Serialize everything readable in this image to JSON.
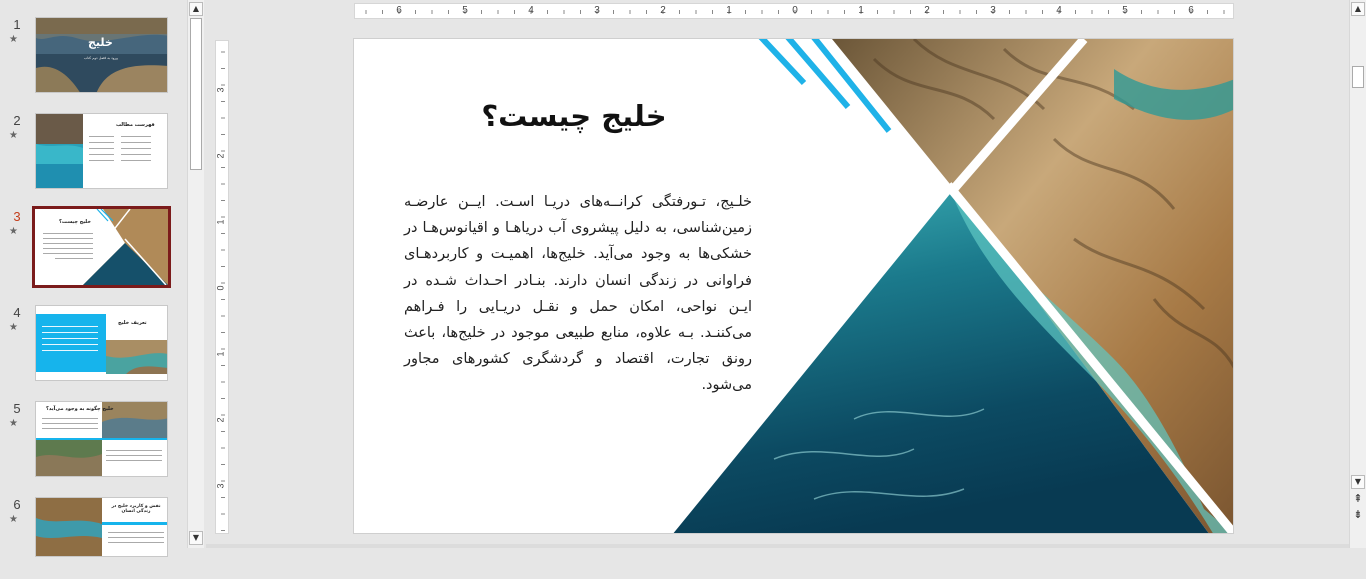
{
  "thumbnails": [
    {
      "number": "1",
      "star": "★",
      "title": "خلیج",
      "subtitle": "ورود به فصل دوم کتاب"
    },
    {
      "number": "2",
      "star": "★",
      "title": "فهرست مطالب"
    },
    {
      "number": "3",
      "star": "★",
      "title": "خلیج چیست؟",
      "selected": true
    },
    {
      "number": "4",
      "star": "★",
      "title": "تعریف خلیج"
    },
    {
      "number": "5",
      "star": "★",
      "title": "خلیج چگونه به وجود می‌آید؟"
    },
    {
      "number": "6",
      "star": "★",
      "title": "نقش و کاربرد خلیج در زندگی انسان"
    }
  ],
  "ruler_h": [
    "6",
    "5",
    "4",
    "3",
    "2",
    "1",
    "0",
    "1",
    "2",
    "3",
    "4",
    "5",
    "6"
  ],
  "ruler_v": [
    "3",
    "2",
    "1",
    "0",
    "1",
    "2",
    "3"
  ],
  "slide": {
    "title": "خلیج چیست؟",
    "body": "خلـیج، تـورفتگی کرانــه‌های دریـا اسـت. ایــن عارضـه زمین‌شناسی، به دلیل پیشروی آب دریاهـا و اقیانوس‌هـا در خشکی‌ها به وجود می‌آید. خلیج‌ها، اهمیـت و کاربردهـای فراوانی در زندگی انسان دارند. بنـادر احـداث شـده در ایـن نواحی، امکان حمل و نقـل دریـایی را فـراهم می‌کننـد. بـه علاوه، منابع طبیعی موجود در خلیج‌ها، باعث رونق تجارت، اقتصاد و گردشگری کشورهای مجاور می‌شود."
  },
  "colors": {
    "accent_stripe": "#1fb2e8",
    "selected_border": "#7b1b1b",
    "active_number": "#c43e1c"
  },
  "icons": {
    "scroll_up": "▲",
    "scroll_down": "▼",
    "prev_slide": "⇞",
    "next_slide": "⇟"
  }
}
